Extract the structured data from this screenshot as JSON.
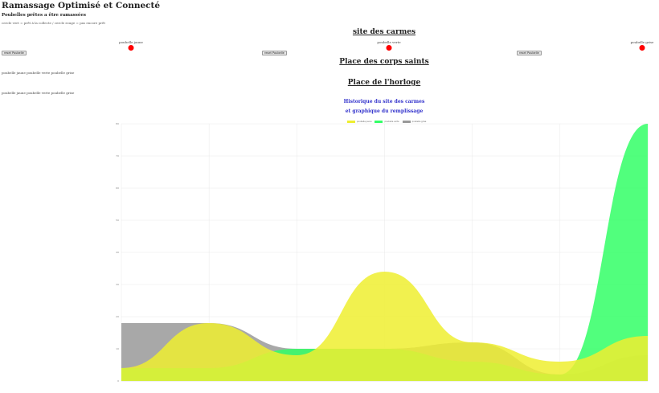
{
  "app": {
    "title": "Ramassage Optimisé et Connecté",
    "subtitle": "Poubelles prêtes a être ramassées",
    "legend_note": "cercle vert = prêt à la collecte / cercle rouge = pas encore prêt"
  },
  "colors": {
    "not_ready": "#ff0000",
    "ready": "#00cc00",
    "series_yellow": "#eeee30",
    "series_green": "#33ff66",
    "series_grey": "#999999",
    "history_title": "#3333cc"
  },
  "sites": [
    {
      "name": "site des carmes",
      "bins": [
        {
          "label": "poubelle jaune",
          "status": "not_ready",
          "reset_label": "reset Poubelle"
        },
        {
          "label": "poubelle verte",
          "status": "not_ready",
          "reset_label": "reset Poubelle"
        },
        {
          "label": "poubelle grise",
          "status": "not_ready",
          "reset_label": "reset Poubelle"
        }
      ]
    },
    {
      "name": "Place des corps saints",
      "bins_text": "poubelle jaune poubelle verte poubelle grise"
    },
    {
      "name": "Place de l'horloge",
      "bins_text": "poubelle jaune poubelle verte poubelle grise"
    }
  ],
  "history": {
    "title_line1": "Historique du site des carmes",
    "title_line2": "et graphique du remplissage"
  },
  "chart_data": {
    "type": "area",
    "x": [
      "",
      "",
      "",
      "",
      "",
      "",
      ""
    ],
    "ylim": [
      0,
      80
    ],
    "yticks": [
      0,
      10,
      20,
      30,
      40,
      50,
      60,
      70,
      80
    ],
    "grid": true,
    "legend_position": "top",
    "smooth": true,
    "series": [
      {
        "name": "poubelle jaune",
        "color": "#eeee30",
        "values": [
          4,
          18,
          8,
          34,
          12,
          6,
          14
        ]
      },
      {
        "name": "poubelle verte",
        "color": "#33ff66",
        "values": [
          4,
          4,
          10,
          10,
          6,
          2,
          80
        ]
      },
      {
        "name": "poubelle grise",
        "color": "#999999",
        "values": [
          18,
          18,
          10,
          10,
          12,
          2,
          8
        ]
      }
    ]
  }
}
